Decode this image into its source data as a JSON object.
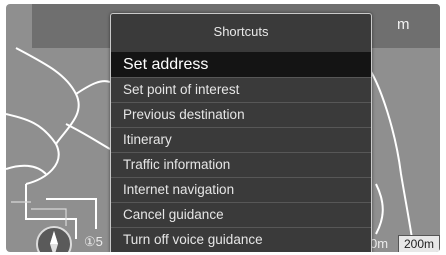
{
  "header": {
    "partial_text": "m"
  },
  "menu": {
    "title": "Shortcuts",
    "items": [
      {
        "label": "Set address",
        "selected": true
      },
      {
        "label": "Set point of interest",
        "selected": false
      },
      {
        "label": "Previous destination",
        "selected": false
      },
      {
        "label": "Itinerary",
        "selected": false
      },
      {
        "label": "Traffic information",
        "selected": false
      },
      {
        "label": "Internet navigation",
        "selected": false
      },
      {
        "label": "Cancel guidance",
        "selected": false
      },
      {
        "label": "Turn off voice guidance",
        "selected": false
      }
    ]
  },
  "status": {
    "left_info": "①5",
    "distance_partial": "0m",
    "scale": "200m"
  },
  "colors": {
    "menu_bg": "#3a3a3a",
    "selected_bg": "#141414",
    "map_bg": "#8f8f8f"
  }
}
